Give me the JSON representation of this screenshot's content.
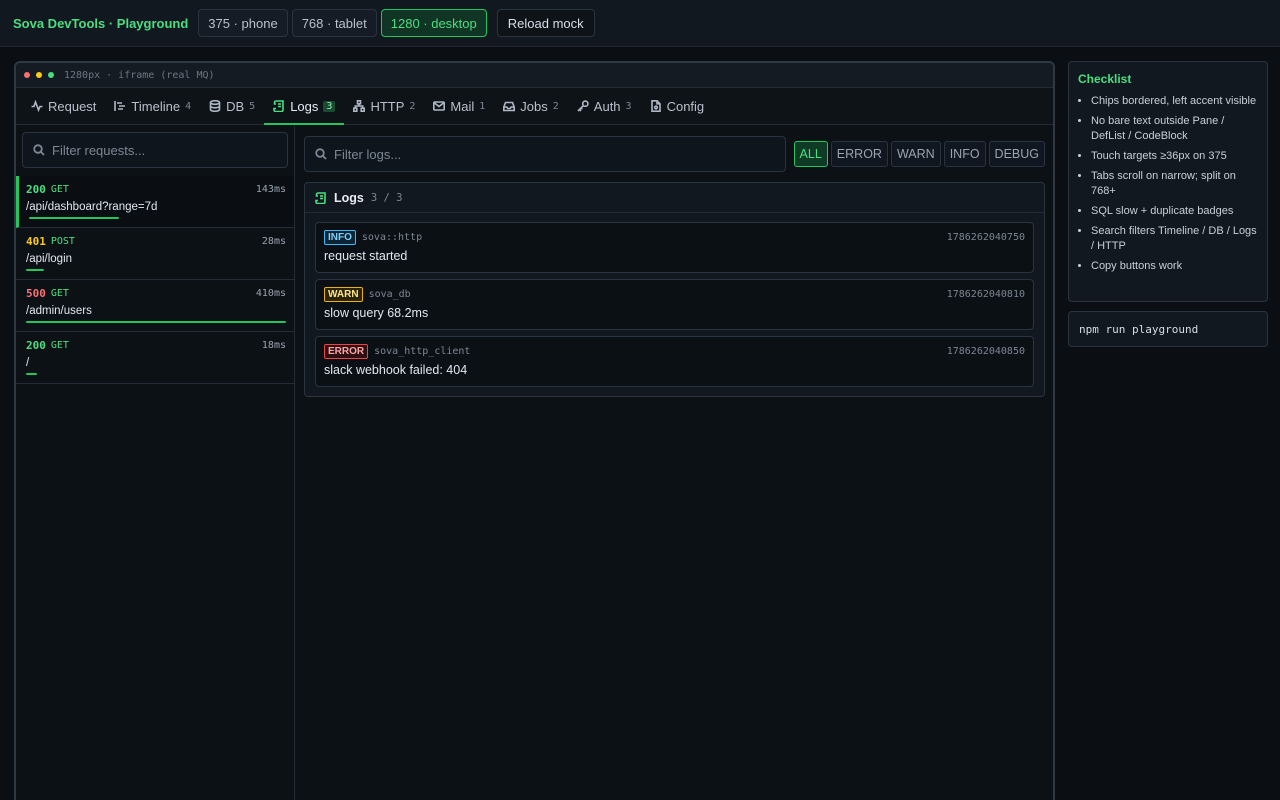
{
  "app": {
    "title": "Sova DevTools · Playground"
  },
  "viewports": [
    {
      "label": "375 · phone",
      "active": false
    },
    {
      "label": "768 · tablet",
      "active": false
    },
    {
      "label": "1280 · desktop",
      "active": true
    }
  ],
  "reload_label": "Reload mock",
  "frame": {
    "caption": "1280px · iframe (real MQ)",
    "dot_colors": [
      "#f87171",
      "#facc15",
      "#4ade80"
    ]
  },
  "tabs": [
    {
      "label": "Request",
      "count": "",
      "icon": "activity-icon"
    },
    {
      "label": "Timeline",
      "count": "4",
      "icon": "timeline-icon"
    },
    {
      "label": "DB",
      "count": "5",
      "icon": "database-icon"
    },
    {
      "label": "Logs",
      "count": "3",
      "icon": "scroll-icon",
      "active": true
    },
    {
      "label": "HTTP",
      "count": "2",
      "icon": "network-icon"
    },
    {
      "label": "Mail",
      "count": "1",
      "icon": "mail-icon"
    },
    {
      "label": "Jobs",
      "count": "2",
      "icon": "inbox-icon"
    },
    {
      "label": "Auth",
      "count": "3",
      "icon": "key-icon"
    },
    {
      "label": "Config",
      "count": "",
      "icon": "file-icon"
    }
  ],
  "requests": {
    "placeholder": "Filter requests...",
    "items": [
      {
        "status": "200",
        "method": "GET",
        "duration": "143ms",
        "path": "/api/dashboard?range=7d",
        "selected": true,
        "relative_duration": 0.35
      },
      {
        "status": "401",
        "method": "POST",
        "duration": "28ms",
        "path": "/api/login",
        "selected": false,
        "relative_duration": 0.068
      },
      {
        "status": "500",
        "method": "GET",
        "duration": "410ms",
        "path": "/admin/users",
        "selected": false,
        "relative_duration": 1.0
      },
      {
        "status": "200",
        "method": "GET",
        "duration": "18ms",
        "path": "/",
        "selected": false,
        "relative_duration": 0.044
      }
    ]
  },
  "logs": {
    "placeholder": "Filter logs...",
    "levels": [
      {
        "label": "ALL",
        "active": true
      },
      {
        "label": "ERROR",
        "active": false
      },
      {
        "label": "WARN",
        "active": false
      },
      {
        "label": "INFO",
        "active": false
      },
      {
        "label": "DEBUG",
        "active": false
      }
    ],
    "pane_title": "Logs",
    "pane_count": "3 / 3",
    "entries": [
      {
        "level": "INFO",
        "source": "sova::http",
        "timestamp": "1786262040750",
        "message": "request started"
      },
      {
        "level": "WARN",
        "source": "sova_db",
        "timestamp": "1786262040810",
        "message": "slow query 68.2ms"
      },
      {
        "level": "ERROR",
        "source": "sova_http_client",
        "timestamp": "1786262040850",
        "message": "slack webhook failed: 404"
      }
    ]
  },
  "checklist": {
    "title": "Checklist",
    "items": [
      "Chips bordered, left accent visible",
      "No bare text outside Pane / DefList / CodeBlock",
      "Touch targets ≥36px on 375",
      "Tabs scroll on narrow; split on 768+",
      "SQL slow + duplicate badges",
      "Search filters Timeline / DB / Logs / HTTP",
      "Copy buttons work"
    ]
  },
  "command": "npm run playground"
}
